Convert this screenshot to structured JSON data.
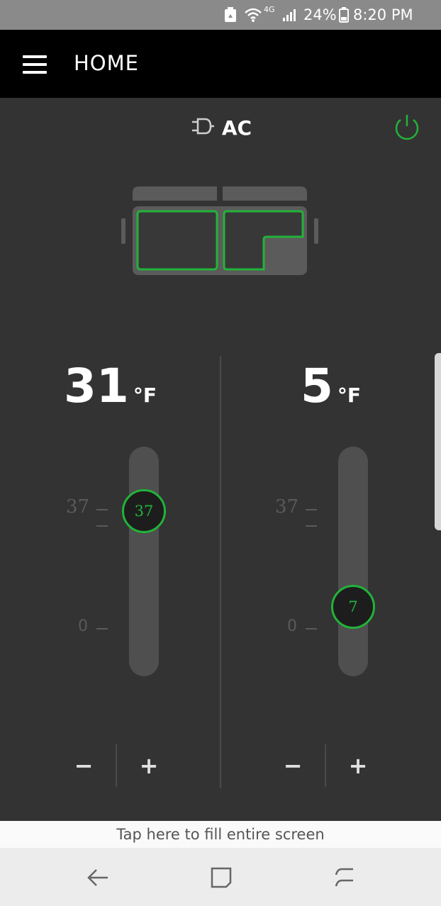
{
  "status_bar": {
    "network": "4G",
    "battery": "24%",
    "time": "8:20 PM",
    "text": "24%  8:20 PM"
  },
  "app_bar": {
    "title": "HOME",
    "menu_icon": "hamburger-menu-icon"
  },
  "power": {
    "mode_label": "AC",
    "source_icon": "power-plug-icon",
    "button_icon": "power-icon",
    "accent_color": "#22b33a"
  },
  "zones": [
    {
      "temperature": "31",
      "unit": "°F",
      "scale_top": "37",
      "scale_bottom": "0",
      "setpoint": "37",
      "setpoint_fraction": 1.0,
      "minus": "−",
      "plus": "+"
    },
    {
      "temperature": "5",
      "unit": "°F",
      "scale_top": "37",
      "scale_bottom": "0",
      "setpoint": "7",
      "setpoint_fraction": 0.19,
      "minus": "−",
      "plus": "+"
    }
  ],
  "fill_banner": "Tap here to fill entire screen",
  "nav_bar": {
    "back_icon": "back-arrow-icon",
    "home_icon": "home-square-icon",
    "recents_icon": "recents-icon"
  }
}
